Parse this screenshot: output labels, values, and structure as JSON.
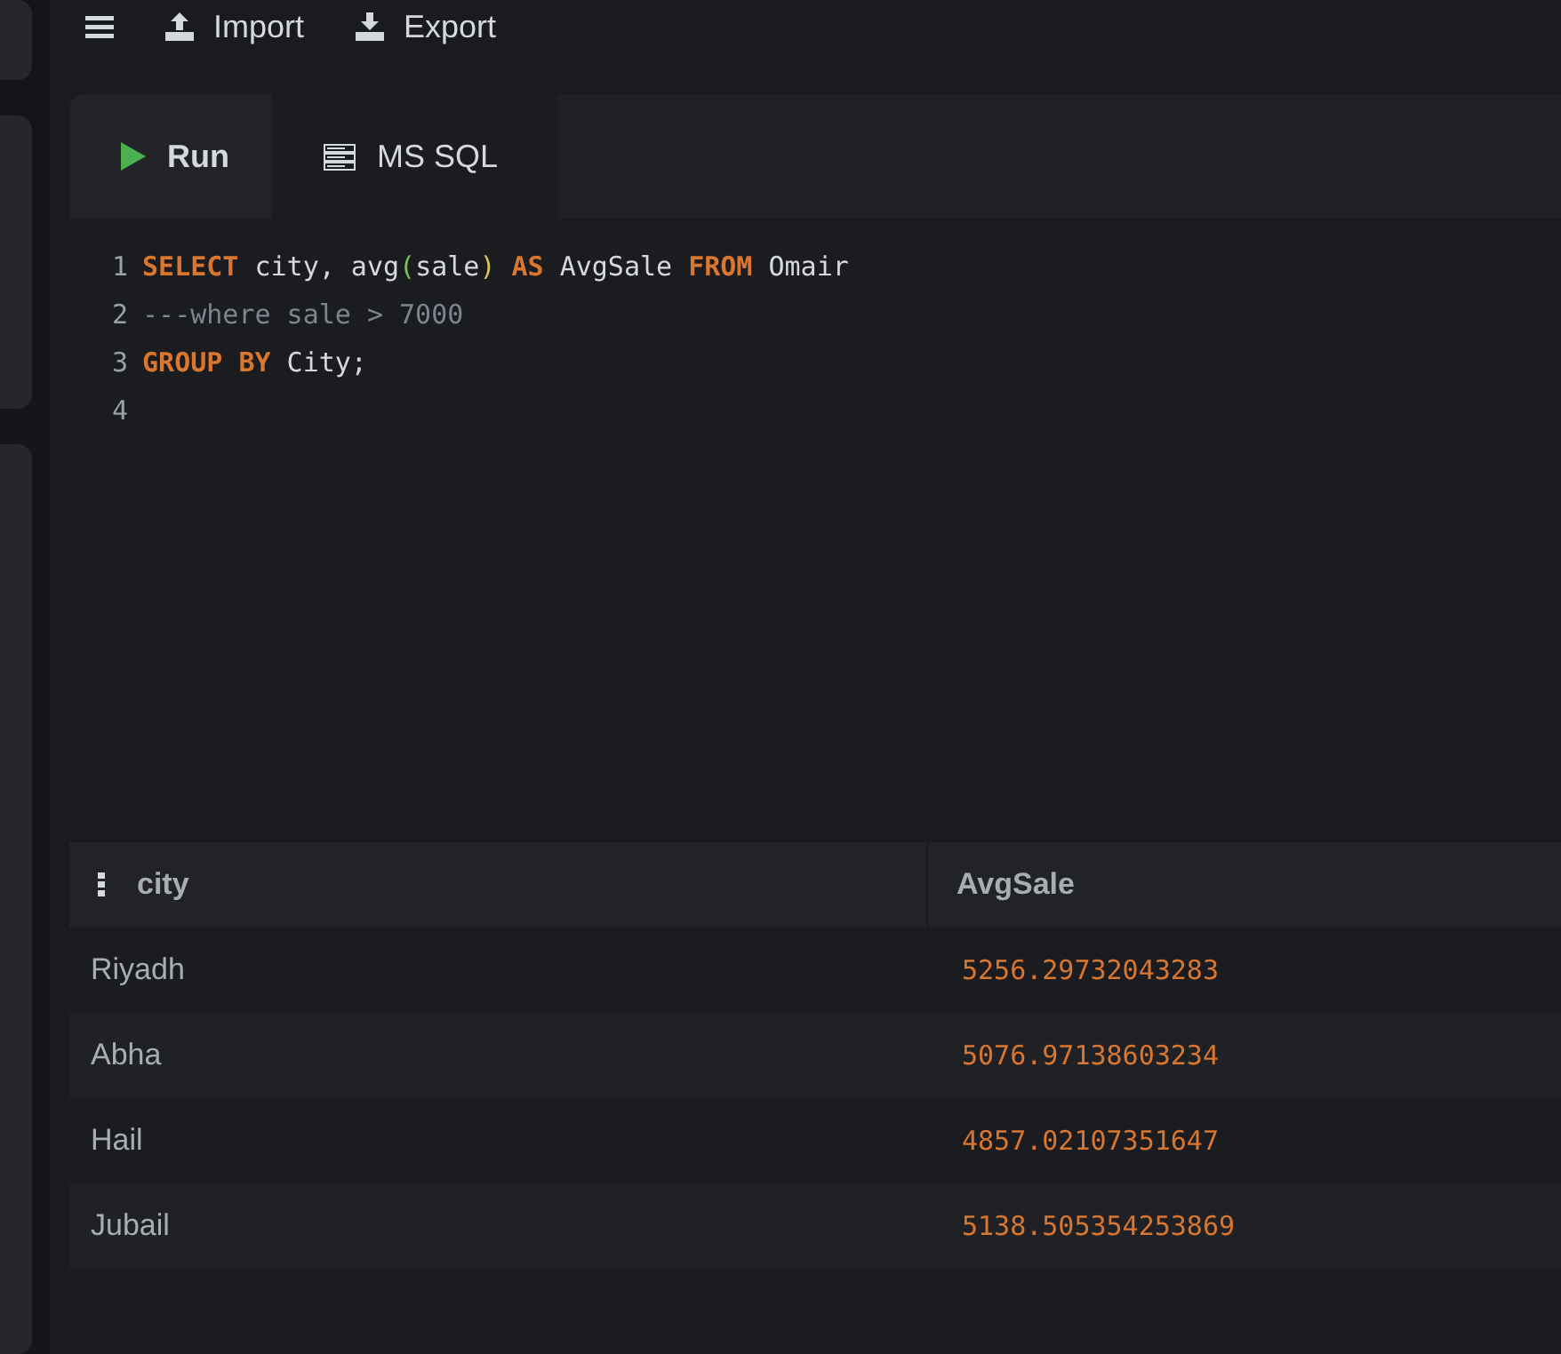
{
  "toolbar": {
    "items": [
      {
        "kind": "menu"
      },
      {
        "kind": "upload",
        "label": "Import"
      },
      {
        "kind": "download",
        "label": "Export"
      }
    ]
  },
  "tabs": [
    {
      "kind": "run",
      "label": "Run",
      "selected": true
    },
    {
      "kind": "database",
      "label": "MS SQL",
      "selected": false
    }
  ],
  "editor": {
    "lines": [
      {
        "number": "1",
        "tokens": [
          {
            "kind": "keyword",
            "text": "SELECT"
          },
          {
            "kind": "ident",
            "text": " city, avg"
          },
          {
            "kind": "open",
            "text": "("
          },
          {
            "kind": "ident",
            "text": "sale"
          },
          {
            "kind": "close",
            "text": ")"
          },
          {
            "kind": "keyword",
            "text": " AS"
          },
          {
            "kind": "ident",
            "text": " AvgSale "
          },
          {
            "kind": "keyword",
            "text": "FROM"
          },
          {
            "kind": "ident",
            "text": " Omair"
          }
        ]
      },
      {
        "number": "2",
        "tokens": [
          {
            "kind": "comment",
            "text": "---where sale > 7000"
          }
        ]
      },
      {
        "number": "3",
        "tokens": [
          {
            "kind": "keyword",
            "text": "GROUP BY"
          },
          {
            "kind": "ident",
            "text": " City;"
          }
        ]
      },
      {
        "number": "4"
      }
    ]
  },
  "table": {
    "columns": [
      "city",
      "AvgSale"
    ],
    "rows": [
      [
        "Riyadh",
        "5256.29732043283"
      ],
      [
        "Abha",
        "5076.97138603234"
      ],
      [
        "Hail",
        "4857.02107351647"
      ],
      [
        "Jubail",
        "5138.505354253869"
      ]
    ]
  }
}
